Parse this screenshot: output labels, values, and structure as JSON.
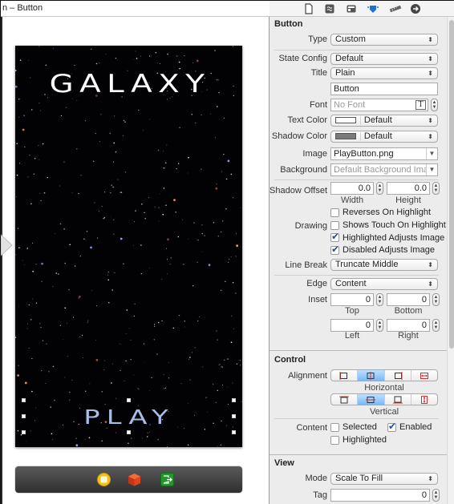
{
  "window": {
    "title": "n – Button"
  },
  "canvas": {
    "scene_title": "GALAXY",
    "play_button_text": "PLAY",
    "dock_icons": [
      "first-responder-icon",
      "cube-icon",
      "exit-icon"
    ]
  },
  "inspector": {
    "tabs": [
      {
        "name": "file-inspector-icon",
        "selected": false
      },
      {
        "name": "quick-help-icon",
        "selected": false
      },
      {
        "name": "identity-inspector-icon",
        "selected": false
      },
      {
        "name": "attributes-inspector-icon",
        "selected": true
      },
      {
        "name": "size-inspector-icon",
        "selected": false
      },
      {
        "name": "connections-inspector-icon",
        "selected": false
      }
    ],
    "button_section": {
      "title": "Button",
      "type_label": "Type",
      "type_value": "Custom",
      "state_config_label": "State Config",
      "state_config_value": "Default",
      "title_label": "Title",
      "title_value": "Plain",
      "title_text_value": "Button",
      "font_label": "Font",
      "font_placeholder": "No Font",
      "text_color_label": "Text Color",
      "text_color_value": "Default",
      "text_color_swatch": "#ffffff",
      "shadow_color_label": "Shadow Color",
      "shadow_color_value": "Default",
      "shadow_color_swatch": "#7a7a7a",
      "image_label": "Image",
      "image_value": "PlayButton.png",
      "background_label": "Background",
      "background_placeholder": "Default Background Imag",
      "shadow_offset_label": "Shadow Offset",
      "shadow_offset_width": "0.0",
      "shadow_offset_height": "0.0",
      "width_label": "Width",
      "height_label": "Height",
      "drawing_label": "Drawing",
      "reverses_on_highlight": {
        "label": "Reverses On Highlight",
        "checked": false
      },
      "shows_touch_on_highlight": {
        "label": "Shows Touch On Highlight",
        "checked": false
      },
      "highlighted_adjusts_image": {
        "label": "Highlighted Adjusts Image",
        "checked": true
      },
      "disabled_adjusts_image": {
        "label": "Disabled Adjusts Image",
        "checked": true
      },
      "line_break_label": "Line Break",
      "line_break_value": "Truncate Middle",
      "edge_label": "Edge",
      "edge_value": "Content",
      "inset_label": "Inset",
      "inset_top": "0",
      "inset_bottom": "0",
      "inset_left": "0",
      "inset_right": "0",
      "top_label": "Top",
      "bottom_label": "Bottom",
      "left_label": "Left",
      "right_label": "Right"
    },
    "control_section": {
      "title": "Control",
      "alignment_label": "Alignment",
      "horizontal_label": "Horizontal",
      "vertical_label": "Vertical",
      "horizontal_selected": "center",
      "vertical_selected": "center",
      "content_label": "Content",
      "selected": {
        "label": "Selected",
        "checked": false
      },
      "enabled": {
        "label": "Enabled",
        "checked": true
      },
      "highlighted": {
        "label": "Highlighted",
        "checked": false
      }
    },
    "view_section": {
      "title": "View",
      "mode_label": "Mode",
      "mode_value": "Scale To Fill",
      "tag_label": "Tag",
      "tag_value": "0"
    }
  }
}
